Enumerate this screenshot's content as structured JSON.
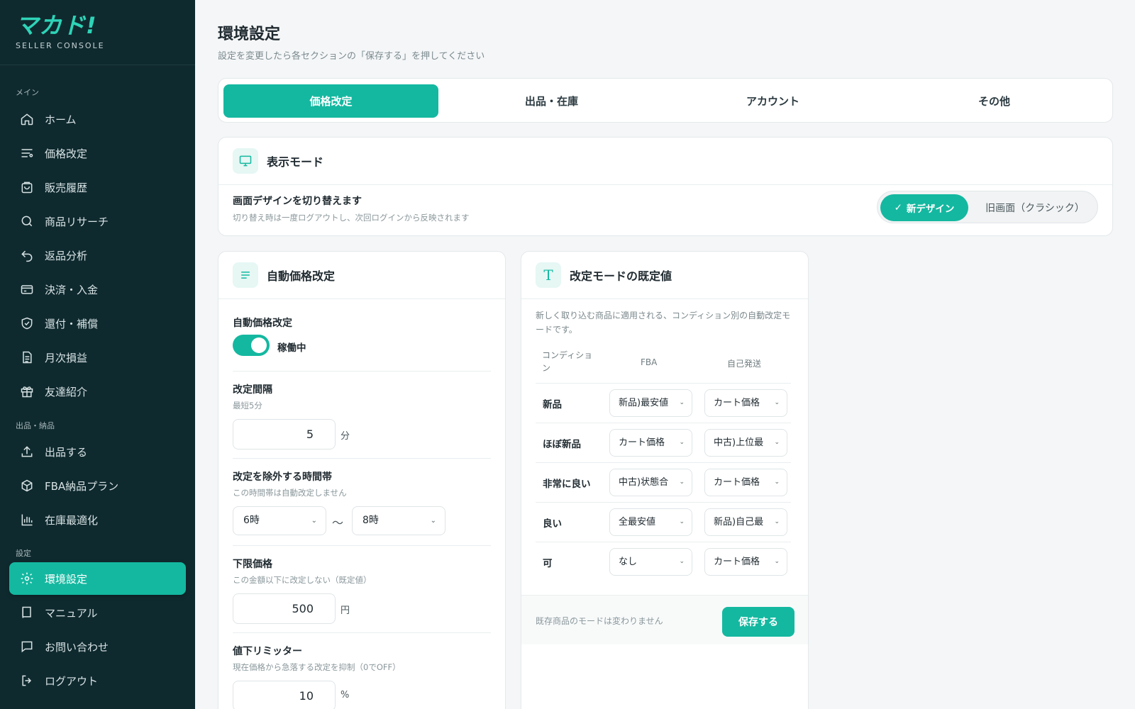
{
  "brand": {
    "logo": "マカド!",
    "subtitle": "SELLER CONSOLE"
  },
  "sidebar": {
    "sections": [
      "メイン",
      "出品・納品",
      "設定"
    ],
    "items": [
      {
        "label": "ホーム",
        "icon": "home-icon"
      },
      {
        "label": "価格改定",
        "icon": "sliders-icon"
      },
      {
        "label": "販売履歴",
        "icon": "shopping-bag-icon"
      },
      {
        "label": "商品リサーチ",
        "icon": "search-icon"
      },
      {
        "label": "返品分析",
        "icon": "undo-icon"
      },
      {
        "label": "決済・入金",
        "icon": "credit-card-icon"
      },
      {
        "label": "還付・補償",
        "icon": "shield-check-icon"
      },
      {
        "label": "月次損益",
        "icon": "document-icon"
      },
      {
        "label": "友達紹介",
        "icon": "gift-icon"
      },
      {
        "label": "出品する",
        "icon": "upload-icon"
      },
      {
        "label": "FBA納品プラン",
        "icon": "box-icon"
      },
      {
        "label": "在庫最適化",
        "icon": "bar-chart-icon"
      },
      {
        "label": "環境設定",
        "icon": "gear-icon",
        "active": true
      },
      {
        "label": "マニュアル",
        "icon": "book-icon"
      },
      {
        "label": "お問い合わせ",
        "icon": "chat-icon"
      },
      {
        "label": "ログアウト",
        "icon": "logout-icon"
      }
    ]
  },
  "header": {
    "title": "環境設定",
    "subtitle": "設定を変更したら各セクションの「保存する」を押してください"
  },
  "tabs": [
    "価格改定",
    "出品・在庫",
    "アカウント",
    "その他"
  ],
  "display_mode": {
    "title": "表示モード",
    "label": "画面デザインを切り替えます",
    "hint": "切り替え時は一度ログアウトし、次回ログインから反映されます",
    "option_new": "新デザイン",
    "option_old": "旧画面（クラシック）",
    "selected": "新デザイン"
  },
  "auto_pricing": {
    "title": "自動価格改定",
    "toggle_label": "自動価格改定",
    "status": "稼働中",
    "enabled": true,
    "interval": {
      "label": "改定間隔",
      "hint": "最短5分",
      "value": "5",
      "unit": "分"
    },
    "exclude": {
      "label": "改定を除外する時間帯",
      "hint": "この時間帯は自動改定しません",
      "from": "6時",
      "sep": "〜",
      "to": "8時"
    },
    "floor": {
      "label": "下限価格",
      "hint": "この金額以下に改定しない（既定値）",
      "value": "500",
      "unit": "円"
    },
    "limiter": {
      "label": "値下リミッター",
      "hint": "現在価格から急落する改定を抑制（0でOFF）",
      "value": "10",
      "unit": "%"
    }
  },
  "defaults": {
    "title": "改定モードの既定値",
    "description": "新しく取り込む商品に適用される、コンディション別の自動改定モードです。",
    "columns": [
      "コンディション",
      "FBA",
      "自己発送"
    ],
    "rows": [
      {
        "condition": "新品",
        "fba": "新品)最安値",
        "self": "カート価格"
      },
      {
        "condition": "ほぼ新品",
        "fba": "カート価格",
        "self": "中古)上位最"
      },
      {
        "condition": "非常に良い",
        "fba": "中古)状態合",
        "self": "カート価格"
      },
      {
        "condition": "良い",
        "fba": "全最安値",
        "self": "新品)自己最"
      },
      {
        "condition": "可",
        "fba": "なし",
        "self": "カート価格"
      }
    ],
    "footer_note": "既存商品のモードは変わりません",
    "save_label": "保存する"
  },
  "colors": {
    "accent": "#14b8a0",
    "sidebar_bg": "#0f2a2f"
  }
}
